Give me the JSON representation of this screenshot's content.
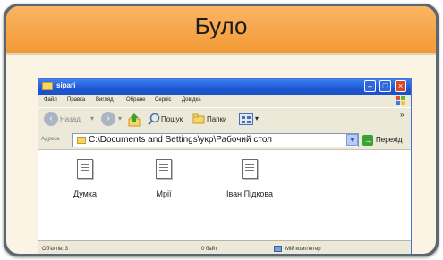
{
  "card": {
    "title": "Було"
  },
  "window": {
    "title": "sipari",
    "menu": [
      "Файл",
      "Правка",
      "Вигляд",
      "Обране",
      "Сервіс",
      "Довідка"
    ],
    "toolbar": {
      "back_label": "Назад",
      "search_label": "Пошук",
      "folders_label": "Папки"
    },
    "address": {
      "label": "Адреса",
      "path": "C:\\Documents and Settings\\укр\\Рабочий стол",
      "go_label": "Перехід"
    },
    "files": [
      {
        "name": "Думка"
      },
      {
        "name": "Мрії"
      },
      {
        "name": "Іван Підкова"
      }
    ],
    "status": {
      "objects": "Об'єктів: 3",
      "size": "0 байт",
      "location": "Мій комп'ютер"
    }
  },
  "colors": {
    "header_orange": "#f39a36",
    "xp_blue": "#1e58d6",
    "close_red": "#d7462a"
  }
}
